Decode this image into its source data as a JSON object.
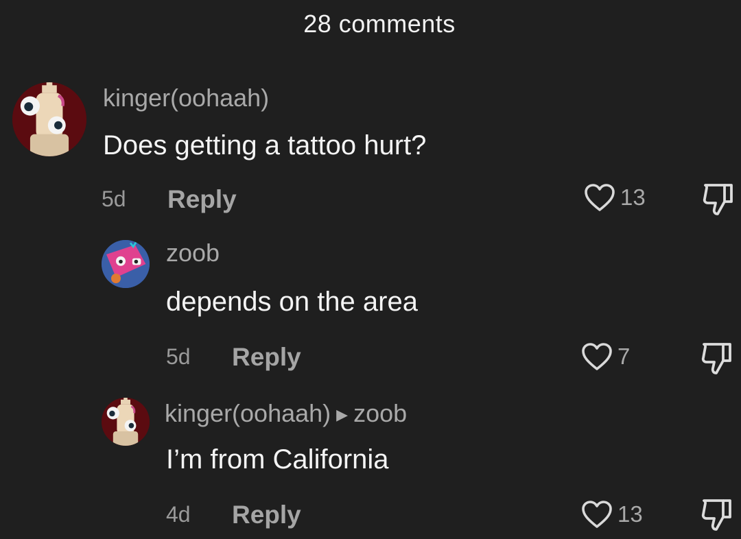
{
  "header": {
    "title": "28 comments"
  },
  "comments": [
    {
      "username": "kinger(oohaah)",
      "text": "Does getting a tattoo hurt?",
      "time": "5d",
      "reply_label": "Reply",
      "likes": "13",
      "avatar_icon": "kinger-avatar"
    },
    {
      "username": "zoob",
      "text": "depends on the area",
      "time": "5d",
      "reply_label": "Reply",
      "likes": "7",
      "avatar_icon": "zoob-avatar"
    },
    {
      "username": "kinger(oohaah)",
      "reply_to": "zoob",
      "text": "I’m from California",
      "time": "4d",
      "reply_label": "Reply",
      "likes": "13",
      "avatar_icon": "kinger-avatar"
    }
  ],
  "icons": {
    "like": "heart-outline-icon",
    "dislike": "thumbs-down-icon",
    "reply_arrow": "play-arrow-icon"
  }
}
